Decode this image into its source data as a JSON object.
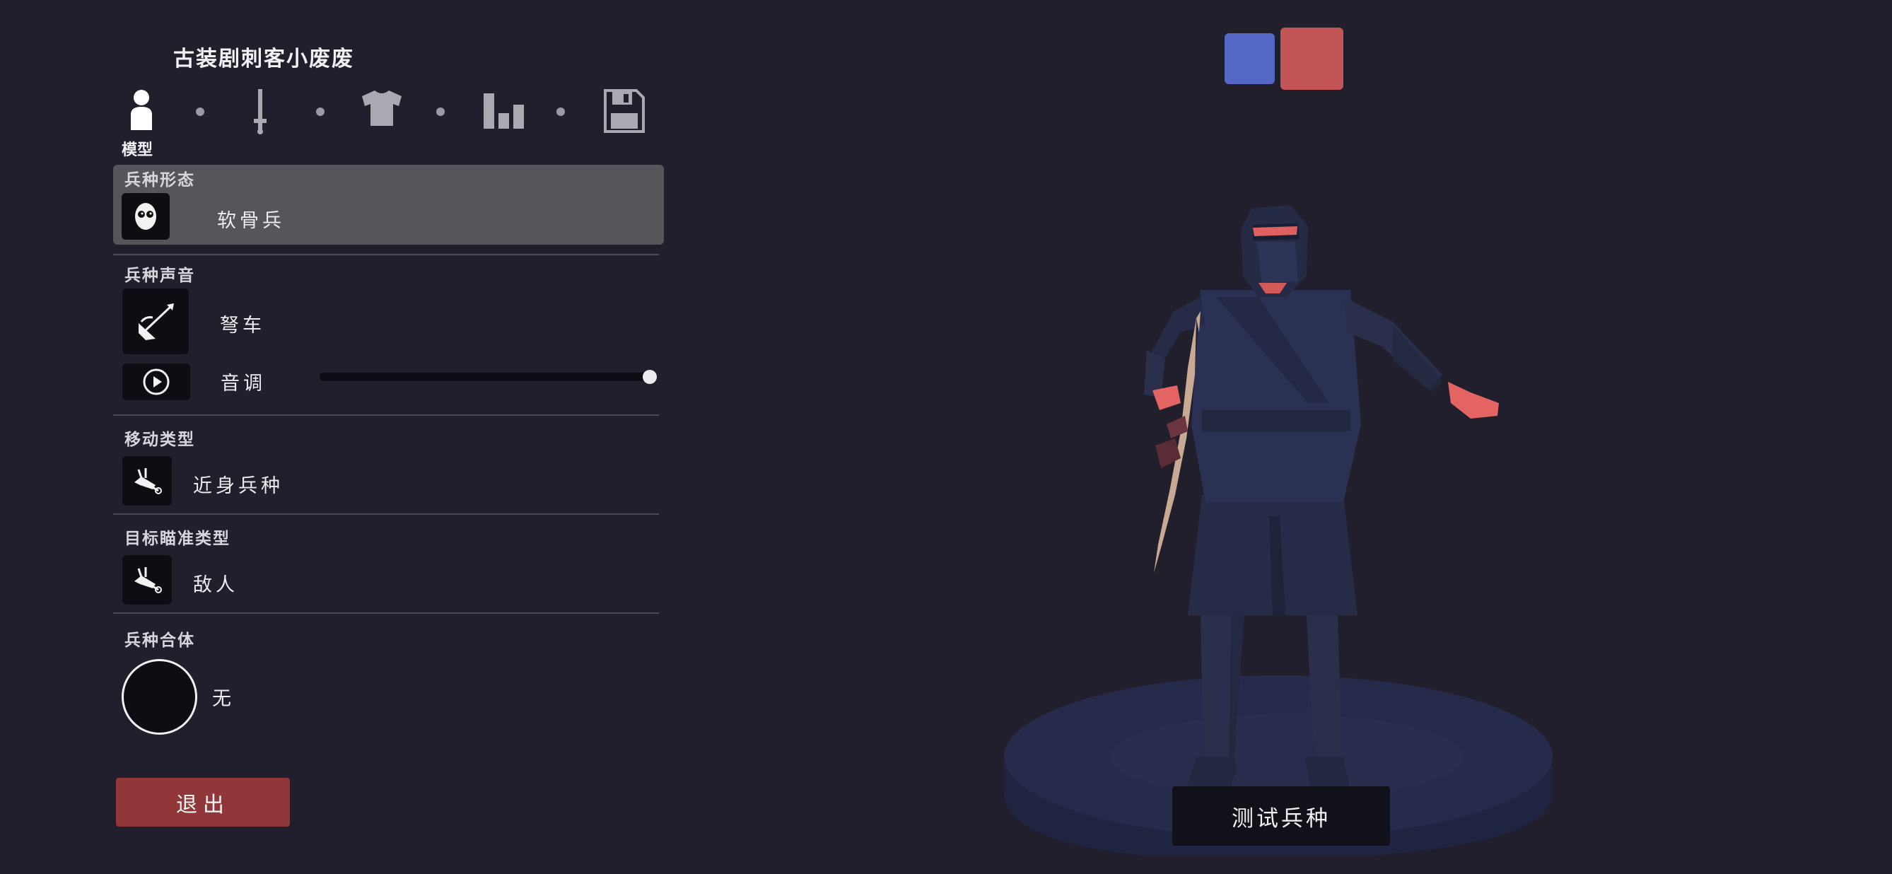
{
  "header": {
    "unit_name": "古装剧刺客小废废"
  },
  "steps": {
    "items": [
      {
        "name": "model",
        "icon": "person-icon",
        "label": "模型",
        "active": true
      },
      {
        "name": "weapon",
        "icon": "sword-icon",
        "active": false
      },
      {
        "name": "clothing",
        "icon": "shirt-icon",
        "active": false
      },
      {
        "name": "stats",
        "icon": "bar-chart-icon",
        "active": false
      },
      {
        "name": "save",
        "icon": "save-icon",
        "active": false
      }
    ]
  },
  "sections": {
    "form": {
      "label": "兵种形态",
      "value": "软骨兵",
      "icon": "face-icon"
    },
    "voice": {
      "label": "兵种声音",
      "value": "弩车",
      "icon": "ballista-icon",
      "play_icon": "play-icon",
      "pitch_label": "音调",
      "pitch_level": 1.0
    },
    "movement": {
      "label": "移动类型",
      "value": "近身兵种",
      "icon": "melee-unit-icon"
    },
    "targeting": {
      "label": "目标瞄准类型",
      "value": "敌人",
      "icon": "melee-unit-icon"
    },
    "combine": {
      "label": "兵种合体",
      "value": "无",
      "icon": "empty-circle-icon"
    }
  },
  "buttons": {
    "exit": "退出",
    "test": "测试兵种"
  },
  "teams": {
    "blue": "#5467c4",
    "red": "#c45556"
  },
  "colors": {
    "background": "#201f2b",
    "selected_row": "#55555a",
    "exit": "#8f3739",
    "ninja_body": "#272c48",
    "ninja_accent": "#e06060",
    "pedestal": "#252a48"
  }
}
